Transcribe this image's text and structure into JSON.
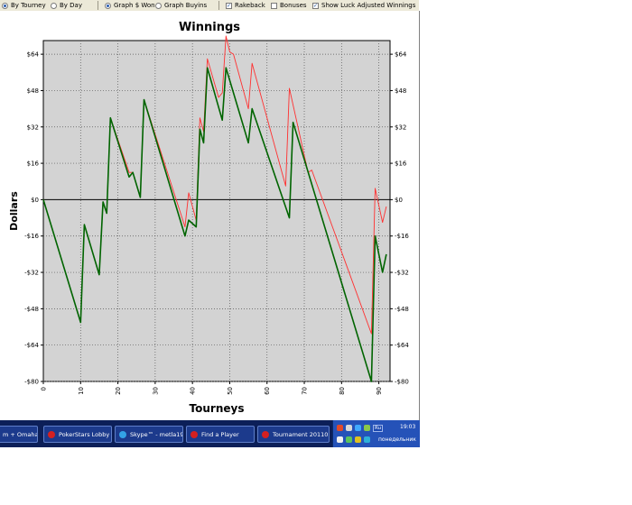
{
  "options": {
    "by_tourney": "By Tourney",
    "by_day": "By Day",
    "graph_won": "Graph $ Won",
    "graph_buyins": "Graph Buyins",
    "rakeback": "Rakeback",
    "bonuses": "Bonuses",
    "luck_adjusted": "Show Luck Adjusted Winnings"
  },
  "option_state": {
    "by_tourney": true,
    "by_day": false,
    "graph_won": true,
    "graph_buyins": false,
    "rakeback": true,
    "bonuses": false,
    "luck_adjusted": true
  },
  "chart_data": {
    "type": "line",
    "title": "Winnings",
    "xlabel": "Tourneys",
    "ylabel": "Dollars",
    "xlim": [
      0,
      93
    ],
    "ylim": [
      -80,
      70
    ],
    "y_ticks": [
      -80,
      -64,
      -48,
      -32,
      -16,
      0,
      16,
      32,
      48,
      64
    ],
    "y_tick_labels": [
      "-$80",
      "-$64",
      "-$48",
      "-$32",
      "-$16",
      "$0",
      "$16",
      "$32",
      "$48",
      "$64"
    ],
    "x_ticks": [
      0,
      10,
      20,
      30,
      40,
      50,
      60,
      70,
      80,
      90
    ],
    "x_tick_labels": [
      "0",
      "10",
      "20",
      "30",
      "40",
      "50",
      "60",
      "70",
      "80",
      "90"
    ],
    "grid": true,
    "series": [
      {
        "color": "#006400",
        "points": [
          [
            0,
            0
          ],
          [
            10,
            -54
          ],
          [
            11,
            -11
          ],
          [
            15,
            -33
          ],
          [
            16,
            -1
          ],
          [
            17,
            -6
          ],
          [
            18,
            36
          ],
          [
            23,
            10
          ],
          [
            24,
            12
          ],
          [
            26,
            1
          ],
          [
            27,
            44
          ],
          [
            38,
            -16
          ],
          [
            39,
            -9
          ],
          [
            41,
            -12
          ],
          [
            42,
            31
          ],
          [
            43,
            25
          ],
          [
            44,
            58
          ],
          [
            48,
            35
          ],
          [
            49,
            58
          ],
          [
            55,
            25
          ],
          [
            56,
            40
          ],
          [
            66,
            -8
          ],
          [
            67,
            34
          ],
          [
            88,
            -80
          ],
          [
            89,
            -16
          ],
          [
            91,
            -32
          ],
          [
            92,
            -24
          ]
        ]
      },
      {
        "color": "#ff3030",
        "points": [
          [
            0,
            0
          ],
          [
            10,
            -54
          ],
          [
            11,
            -11
          ],
          [
            15,
            -33
          ],
          [
            16,
            -1
          ],
          [
            17,
            -6
          ],
          [
            18,
            36
          ],
          [
            23,
            12
          ],
          [
            24,
            12
          ],
          [
            26,
            1
          ],
          [
            27,
            44
          ],
          [
            38,
            -12
          ],
          [
            39,
            3
          ],
          [
            41,
            -9
          ],
          [
            42,
            36
          ],
          [
            43,
            30
          ],
          [
            44,
            62
          ],
          [
            47,
            45
          ],
          [
            48,
            47
          ],
          [
            49,
            72
          ],
          [
            50,
            65
          ],
          [
            51,
            64
          ],
          [
            55,
            40
          ],
          [
            56,
            60
          ],
          [
            65,
            6
          ],
          [
            66,
            49
          ],
          [
            71,
            12
          ],
          [
            72,
            13
          ],
          [
            88,
            -59
          ],
          [
            89,
            5
          ],
          [
            91,
            -10
          ],
          [
            92,
            -3
          ]
        ]
      }
    ]
  },
  "taskbar": {
    "items": [
      "m + Omaha ...",
      "PokerStars Lobby -...",
      "Skype™ - metla1987",
      "Find a Player",
      "Tournament 20110..."
    ],
    "clock": "19:03",
    "day": "понедельник",
    "lang": "Ru"
  }
}
